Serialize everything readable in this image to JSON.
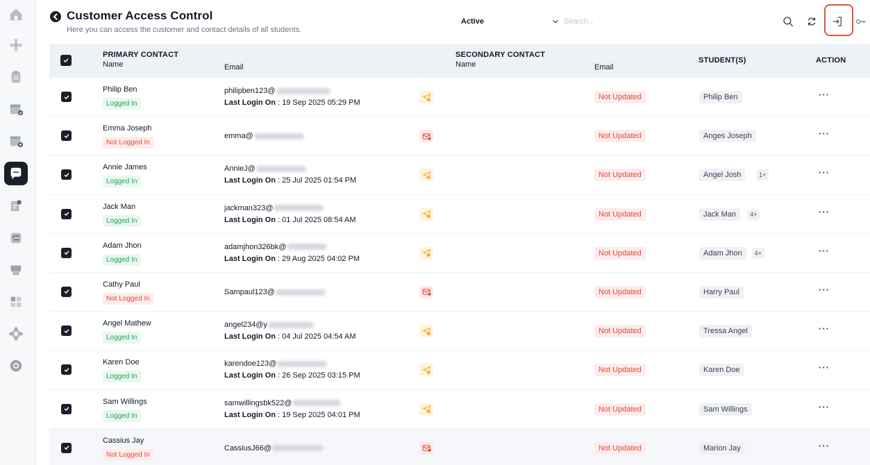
{
  "header": {
    "title": "Customer Access Control",
    "subtitle": "Here you can access the customer and contact details of all students.",
    "status_filter": "Active",
    "search_placeholder": "Search..."
  },
  "table": {
    "columns": {
      "primary_contact": "PRIMARY CONTACT",
      "name": "Name",
      "email": "Email",
      "secondary_contact": "SECONDARY CONTACT",
      "secondary_name": "Name",
      "secondary_email": "Email",
      "students": "STUDENT(S)",
      "action": "ACTION"
    },
    "last_login_label": "Last Login On",
    "rows": [
      {
        "name": "Philip Ben",
        "status": "Logged In",
        "email": "philipben123@",
        "last_login": " : 19 Sep 2025 05:29 PM",
        "secondary_email": "Not Updated",
        "student": "Philip Ben",
        "more": ""
      },
      {
        "name": "Emma Joseph",
        "status": "Not Logged In",
        "email": "emma@",
        "last_login": "",
        "secondary_email": "Not Updated",
        "student": "Anges Joseph",
        "more": ""
      },
      {
        "name": "Annie James",
        "status": "Logged In",
        "email": "AnnieJ@",
        "last_login": " : 25 Jul 2025 01:54 PM",
        "secondary_email": "Not Updated",
        "student": "Angel Josh",
        "more": "1+"
      },
      {
        "name": "Jack Man",
        "status": "Logged In",
        "email": "jackman323@",
        "last_login": " : 01 Jul 2025 08:54 AM",
        "secondary_email": "Not Updated",
        "student": "Jack Man",
        "more": "4+"
      },
      {
        "name": "Adam Jhon",
        "status": "Logged In",
        "email": "adamjhon326bk@",
        "last_login": " : 29 Aug 2025 04:02 PM",
        "secondary_email": "Not Updated",
        "student": "Adam Jhon",
        "more": "4+"
      },
      {
        "name": "Cathy Paul",
        "status": "Not Logged In",
        "email": "Sampaul123@",
        "last_login": "",
        "secondary_email": "Not Updated",
        "student": "Harry Paul",
        "more": ""
      },
      {
        "name": "Angel Mathew",
        "status": "Logged In",
        "email": "angel234@y",
        "last_login": " : 04 Jul 2025 04:54 AM",
        "secondary_email": "Not Updated",
        "student": "Tressa Angel",
        "more": ""
      },
      {
        "name": "Karen Doe",
        "status": "Logged In",
        "email": "karendoe123@",
        "last_login": " : 26 Sep 2025 03:15 PM",
        "secondary_email": "Not Updated",
        "student": "Karen Doe",
        "more": ""
      },
      {
        "name": "Sam Willings",
        "status": "Logged In",
        "email": "samwillingsbk522@",
        "last_login": " : 19 Sep 2025 04:01 PM",
        "secondary_email": "Not Updated",
        "student": "Sam Willings",
        "more": ""
      },
      {
        "name": "Cassius Jay",
        "status": "Not Logged In",
        "email": "CassiusJ66@",
        "last_login": "",
        "secondary_email": "Not Updated",
        "student": "Marion Jay",
        "more": ""
      }
    ]
  },
  "colors": {
    "accent_dark": "#1b1f2a",
    "logged_in": "#22a35a",
    "not_logged_in": "#e04b3b",
    "highlight": "#e05541"
  },
  "icons": {
    "sidebar": [
      "home-icon",
      "settings-flower-icon",
      "clipboard-icon",
      "calendar-check-icon",
      "calendar-settings-icon",
      "chat-icon",
      "notes-icon",
      "tasks-icon",
      "store-icon",
      "dashboard-grid-icon",
      "cog-icon",
      "support-icon"
    ],
    "header": [
      "search-icon",
      "refresh-icon",
      "login-icon",
      "key-icon"
    ]
  }
}
